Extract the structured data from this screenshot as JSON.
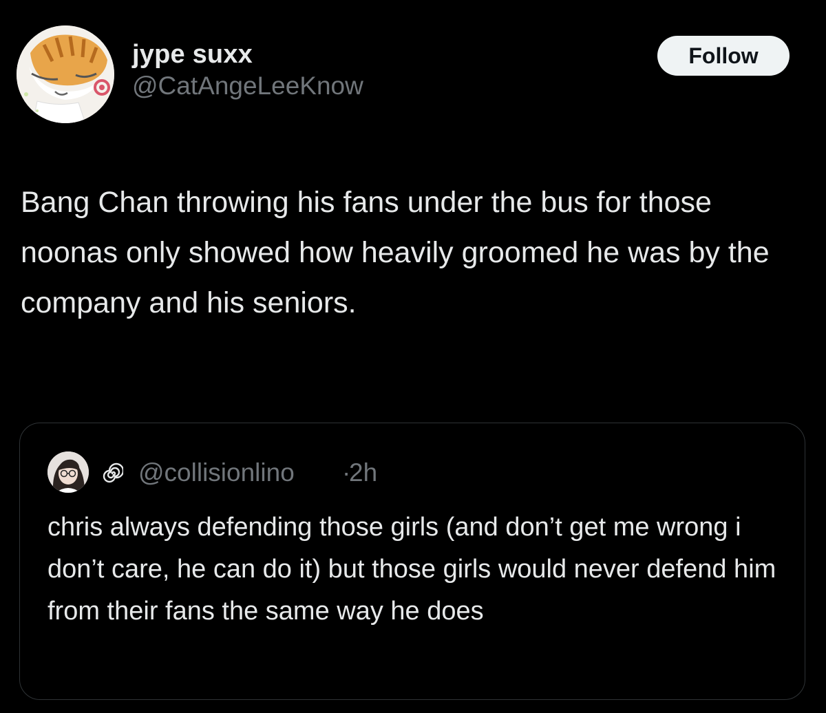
{
  "post": {
    "author": {
      "display_name": "jype suxx",
      "handle": "@CatAngeLeeKnow",
      "avatar_icon": "cat-avatar-icon"
    },
    "follow_label": "Follow",
    "text": "Bang Chan throwing his fans under the bus for those noonas only showed how heavily groomed he was by the company and his seniors."
  },
  "quote": {
    "author": {
      "avatar_icon": "girl-avatar-icon",
      "badge_icon": "spiral-icon",
      "handle": "@collisionlino",
      "separator": "·",
      "time": "2h"
    },
    "text": "chris always defending those girls (and don’t get me wrong i don’t care, he can do it) but those girls would never defend him from their fans the same way he does"
  },
  "colors": {
    "background": "#000000",
    "primary_text": "#e7e9ea",
    "secondary_text": "#71767b",
    "border": "#2f3336",
    "follow_bg": "#eff3f4",
    "follow_text": "#0f1419"
  }
}
